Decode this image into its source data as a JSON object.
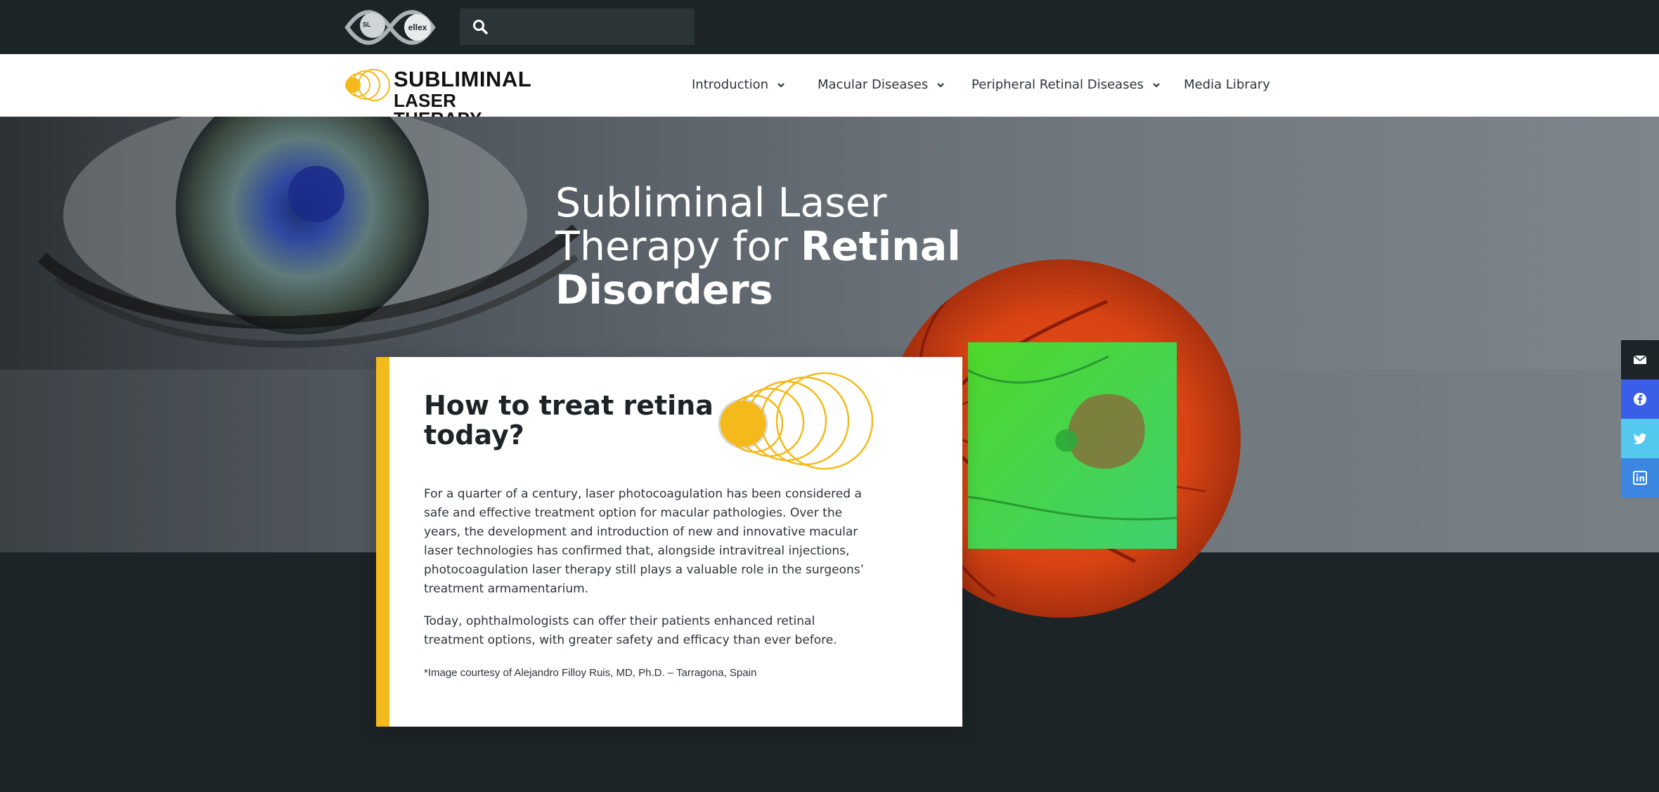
{
  "search": {
    "placeholder": ""
  },
  "site_logo": {
    "line1": "SUBLIMINAL",
    "line2": "LASER THERAPY"
  },
  "nav": {
    "items": [
      {
        "label": "Introduction",
        "dropdown": true
      },
      {
        "label": "Macular Diseases",
        "dropdown": true
      },
      {
        "label": "Peripheral Retinal Diseases",
        "dropdown": true
      },
      {
        "label": "Media Library",
        "dropdown": false
      }
    ]
  },
  "hero": {
    "title_part1": "Subliminal Laser Therapy for ",
    "title_bold": "Retinal Disorders"
  },
  "card": {
    "heading": "How to treat retina today?",
    "paragraph1": "For a quarter of a century, laser photocoagulation has been considered a safe and effective treatment option for macular pathologies. Over the years, the development and introduction of new and innovative macular laser technologies has confirmed that, alongside intravitreal injections, photocoagulation laser therapy still plays a valuable role in the surgeons’ treatment armamentarium.",
    "paragraph2": "Today, ophthalmologists can offer their patients enhanced retinal treatment options, with greater safety and efficacy than ever before.",
    "credit": "*Image courtesy of Alejandro Filloy Ruis, MD, Ph.D. – Tarragona, Spain"
  },
  "social": [
    {
      "icon": "envelope-icon",
      "color": "#1d2427"
    },
    {
      "icon": "facebook-icon",
      "color": "#3b5ee8"
    },
    {
      "icon": "twitter-icon",
      "color": "#55c8f0"
    },
    {
      "icon": "linkedin-icon",
      "color": "#3a86e0"
    }
  ],
  "colors": {
    "accent": "#f4b91a",
    "dark": "#1d2427"
  }
}
